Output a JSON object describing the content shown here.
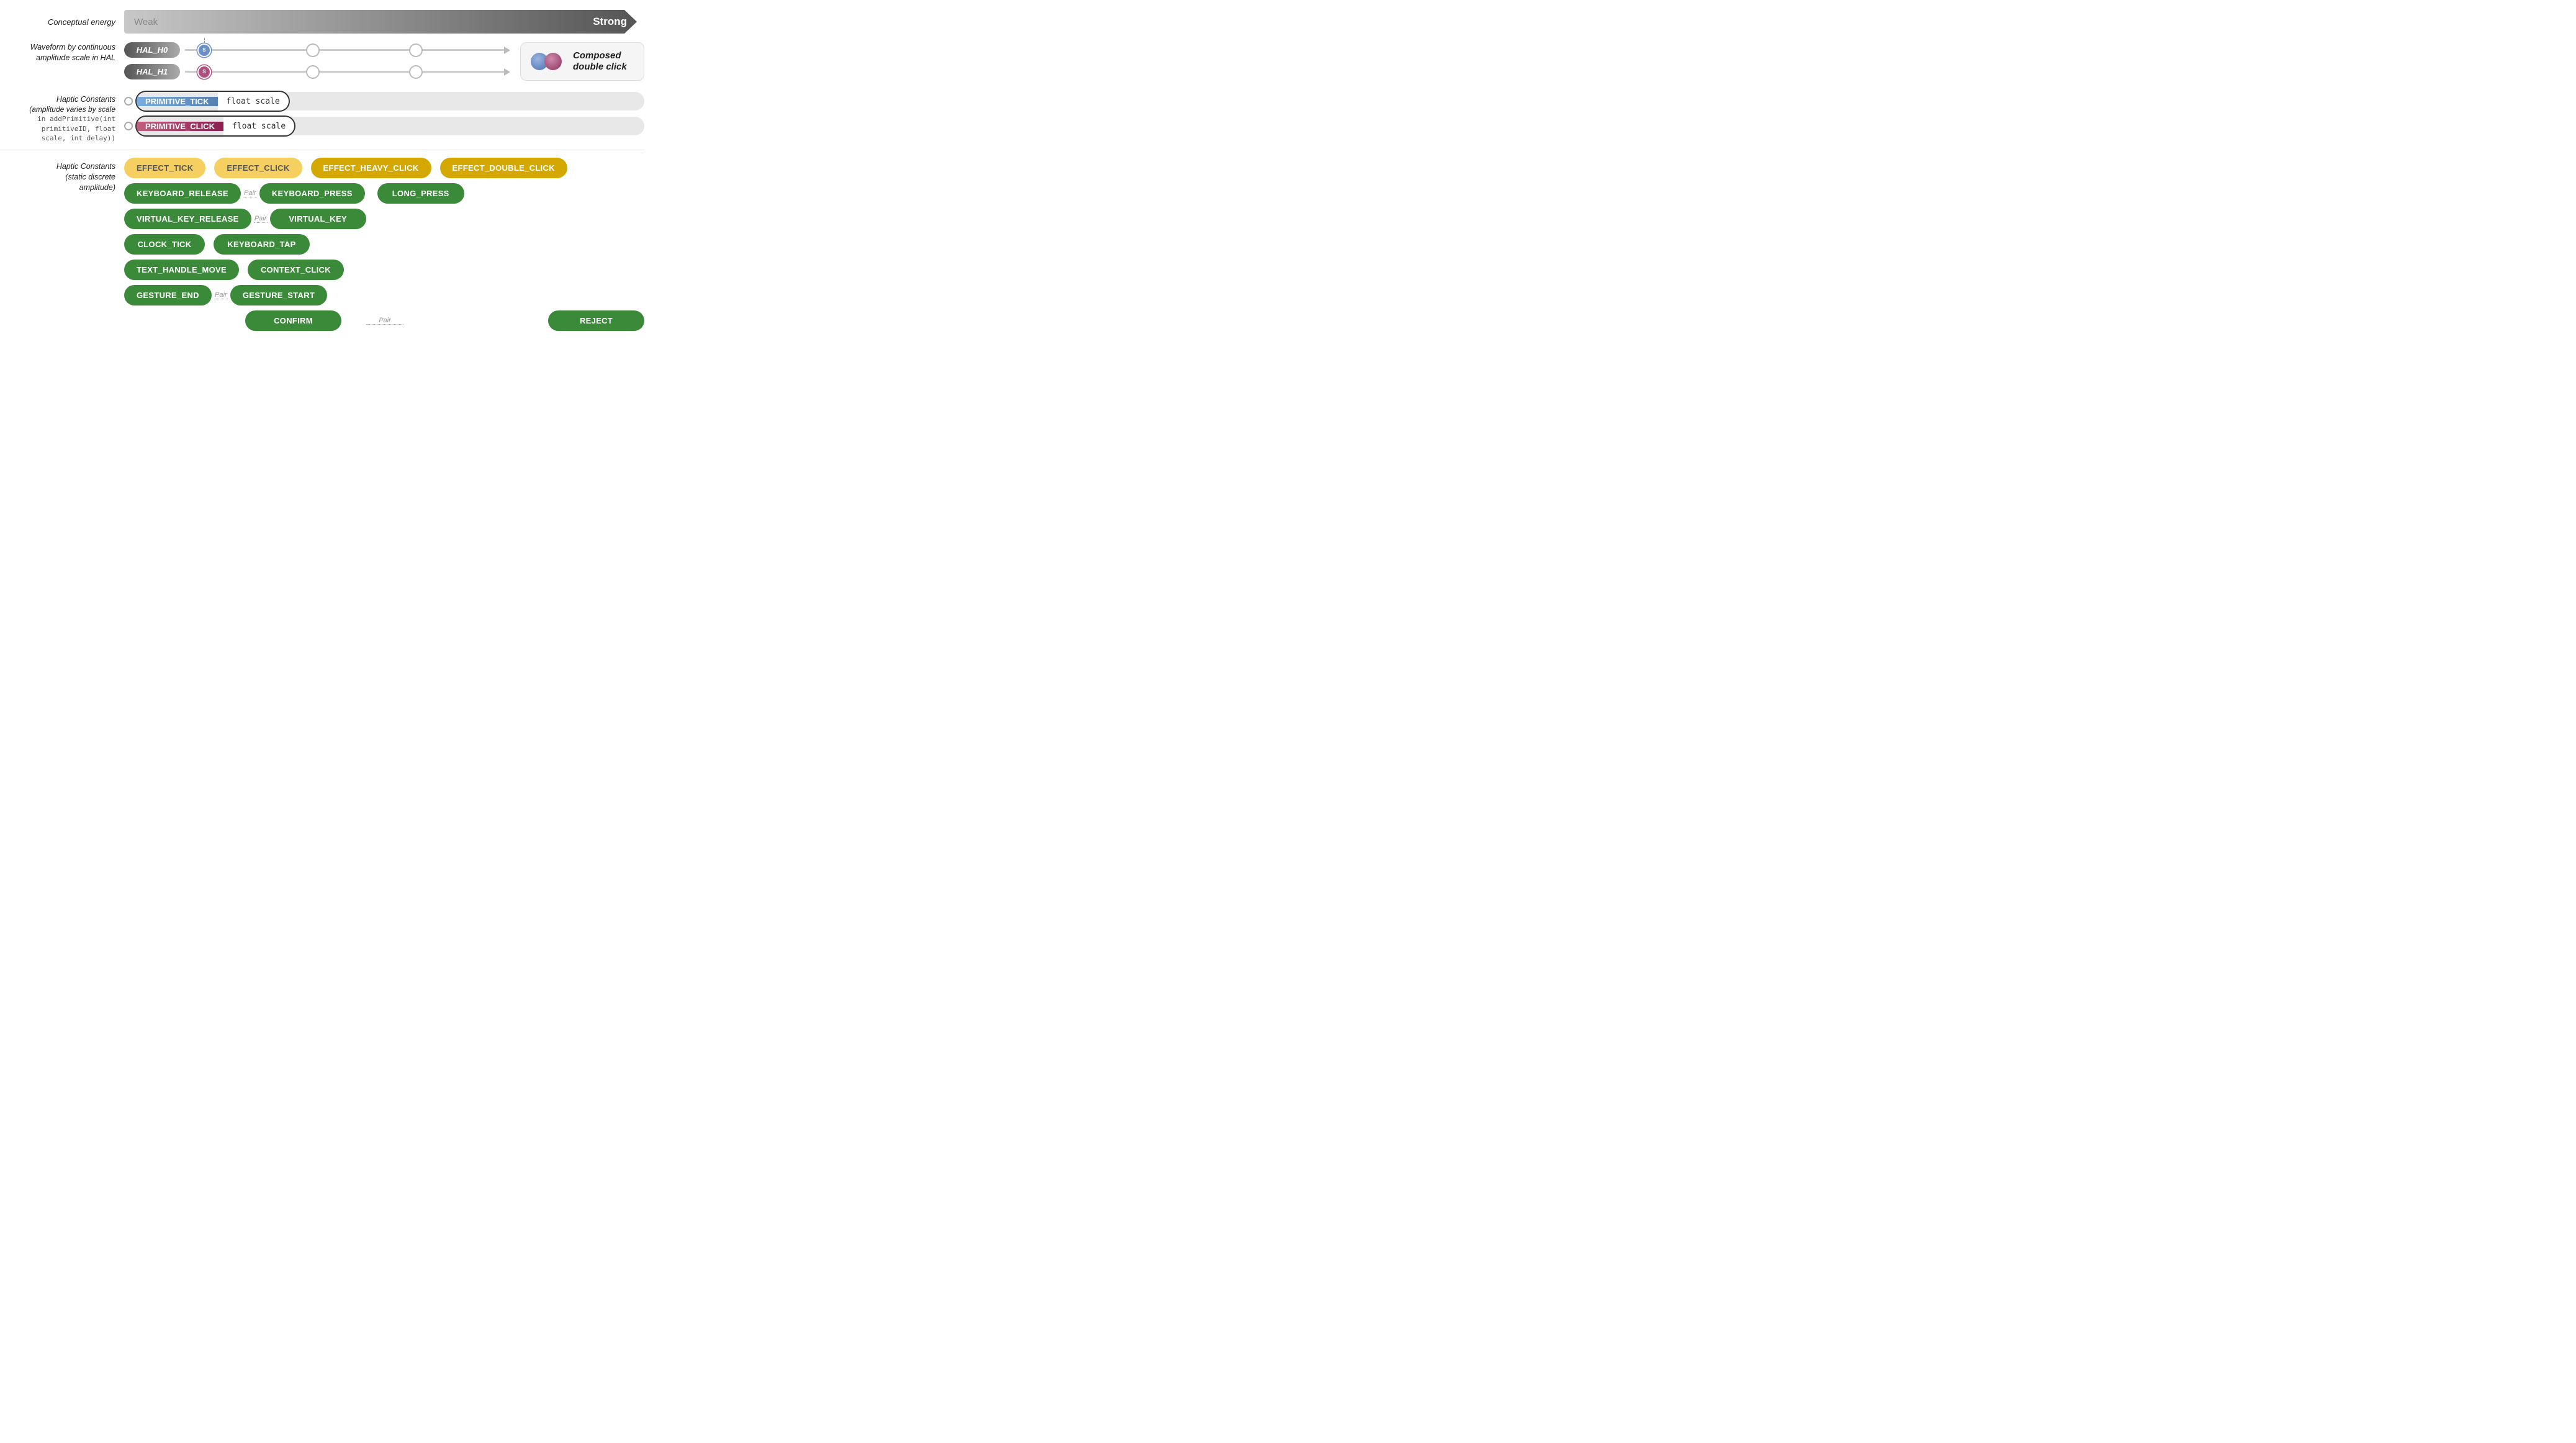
{
  "energy": {
    "label": "Conceptual energy",
    "weak": "Weak",
    "strong": "Strong"
  },
  "waveform": {
    "label": "Waveform by continuous\namplitude scale in HAL"
  },
  "hal": {
    "h0": "HAL_H0",
    "h1": "HAL_H1",
    "start_label": "S",
    "composed_title": "Composed\ndouble click"
  },
  "primitives": {
    "label_line1": "Haptic Constants",
    "label_line2": "(amplitude varies by scale",
    "label_line3": "in addPrimitive(int",
    "label_line4": "primitiveID, float",
    "label_line5": "scale, int delay))",
    "tick_name": "PRIMITIVE_TICK",
    "tick_param": "float scale",
    "click_name": "PRIMITIVE_CLICK",
    "click_param": "float scale"
  },
  "effects": {
    "tick": "EFFECT_TICK",
    "click": "EFFECT_CLICK",
    "heavy_click": "EFFECT_HEAVY_CLICK",
    "double_click": "EFFECT_DOUBLE_CLICK"
  },
  "constants": {
    "label_line1": "Haptic Constants",
    "label_line2": "(static discrete",
    "label_line3": "amplitude)",
    "keyboard_release": "KEYBOARD_RELEASE",
    "keyboard_press": "KEYBOARD_PRESS",
    "long_press": "LONG_PRESS",
    "virtual_key_release": "VIRTUAL_KEY_RELEASE",
    "virtual_key": "VIRTUAL_KEY",
    "clock_tick": "CLOCK_TICK",
    "keyboard_tap": "KEYBOARD_TAP",
    "text_handle_move": "TEXT_HANDLE_MOVE",
    "context_click": "CONTEXT_CLICK",
    "gesture_end": "GESTURE_END",
    "gesture_start": "GESTURE_START",
    "confirm": "CONFIRM",
    "pair_label": "Pair",
    "reject": "REJECT"
  },
  "colors": {
    "yellow_light": "#f5d060",
    "yellow_dark": "#c89000",
    "green": "#3a8a3a",
    "blue_dot": "#6a8fc8",
    "pink_dot": "#b05080"
  }
}
